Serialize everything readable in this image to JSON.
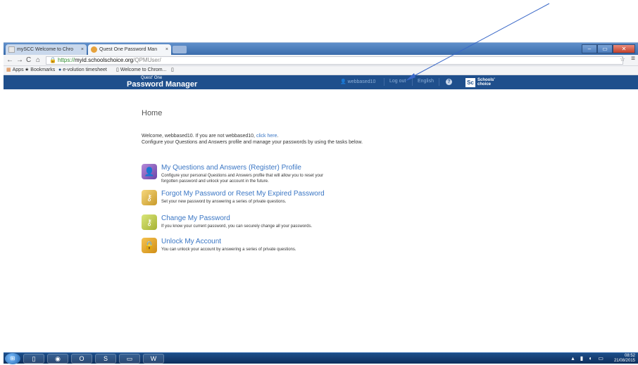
{
  "browser": {
    "tabs": [
      {
        "label": "mySCC Welcome to Chro"
      },
      {
        "label": "Quest One Password Man"
      }
    ],
    "tab_close": "×",
    "window_controls": {
      "minimize": "–",
      "maximize": "▭",
      "close": "✕"
    },
    "url": {
      "scheme": "https://",
      "host": "myid.schoolschoice.org",
      "path": "/QPMUser/"
    },
    "bookmarks": [
      {
        "label": "Apps",
        "icon": "apps-grid-icon"
      },
      {
        "label": "Bookmarks",
        "icon": "star-icon"
      },
      {
        "label": "e-volution timesheet",
        "icon": "e-icon"
      },
      {
        "label": "Welcome to Chrom...",
        "icon": "page-icon"
      }
    ]
  },
  "site_header": {
    "brand_small": "Quest' One",
    "brand_title": "Password Manager",
    "username": "webbased10",
    "logout": "Log out",
    "language": "English",
    "help": "?",
    "logo_mark": "Sc",
    "logo_text_1": "Schools'",
    "logo_text_2": "choice"
  },
  "main": {
    "page_title": "Home",
    "welcome_line_1_prefix": "Welcome, webbased10. If you are not webbased10,",
    "welcome_click_here": "click here",
    "welcome_line_1_suffix": ".",
    "welcome_line_2": "Configure your Questions and Answers profile and manage your passwords by using the tasks below.",
    "tasks": [
      {
        "title": "My Questions and Answers (Register) Profile",
        "desc_1": "Configure your personal Questions and Answers profile that will allow you to reset your",
        "desc_2": "forgotten password and unlock your account in the future.",
        "icon": "user-profile-icon"
      },
      {
        "title": "Forgot My Password or Reset My Expired Password",
        "desc_1": "Set your new password by answering a series of private questions.",
        "icon": "keys-icon"
      },
      {
        "title": "Change My Password",
        "desc_1": "If you know your current password, you can securely change all your passwords.",
        "icon": "key-change-icon"
      },
      {
        "title": "Unlock My Account",
        "desc_1": "You can unlock your account by answering a series of private questions.",
        "icon": "padlock-icon"
      }
    ]
  },
  "taskbar": {
    "apps": [
      "explorer-icon",
      "chrome-icon",
      "outlook-icon",
      "skype-icon",
      "folder-icon",
      "word-icon"
    ],
    "time": "08:52",
    "date": "21/08/2015"
  },
  "colors": {
    "header_bg": "#1f4f8c",
    "link": "#3a76c4",
    "annotation_arrow": "#3a68c8"
  }
}
